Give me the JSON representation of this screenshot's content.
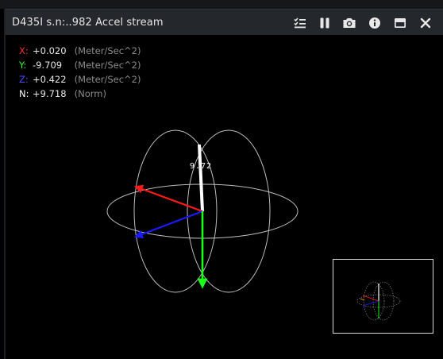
{
  "window": {
    "title": "D435I s.n:..982 Accel stream"
  },
  "toolbar": {
    "icons": [
      "list-settings-icon",
      "pause-icon",
      "camera-icon",
      "info-icon",
      "minimize-window-icon",
      "close-icon"
    ]
  },
  "readouts": [
    {
      "axis": "X:",
      "value": "+0.020",
      "unit": "(Meter/Sec^2)",
      "color": "#ff3333"
    },
    {
      "axis": "Y:",
      "value": "-9.709",
      "unit": "(Meter/Sec^2)",
      "color": "#33ff33"
    },
    {
      "axis": "Z:",
      "value": "+0.422",
      "unit": "(Meter/Sec^2)",
      "color": "#4d4dff"
    },
    {
      "axis": "N:",
      "value": "+9.718",
      "unit": "(Norm)",
      "color": "#ffffff"
    }
  ],
  "visualization": {
    "norm_label": "9.72",
    "vector_colors": {
      "x": "#ff1a1a",
      "y": "#19ff19",
      "z": "#1a1aff",
      "norm": "#ffffff",
      "sphere": "#bdbdbd"
    }
  }
}
